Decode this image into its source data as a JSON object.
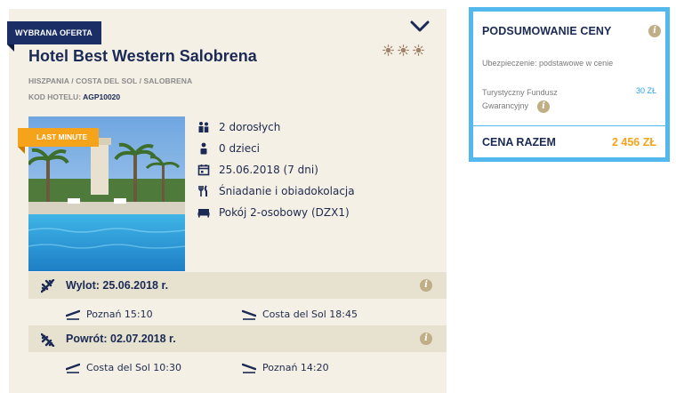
{
  "offer": {
    "ribbon": "WYBRANA OFERTA",
    "hotel_name": "Hotel Best Western Salobrena",
    "location": "HISZPANIA / COSTA DEL SOL / SALOBRENA",
    "hotel_code_label": "KOD HOTELU:",
    "hotel_code": "AGP10020",
    "star_rating": 3,
    "badge": "LAST MINUTE",
    "details": {
      "adults": "2 dorosłych",
      "children": "0 dzieci",
      "date": "25.06.2018 (7 dni)",
      "board": "Śniadanie i obiadokolacja",
      "room": "Pokój 2-osobowy (DZX1)"
    },
    "outbound": {
      "title": "Wylot: 25.06.2018 r.",
      "depart": "Poznań 15:10",
      "arrive": "Costa del Sol 18:45"
    },
    "return": {
      "title": "Powrót: 02.07.2018 r.",
      "depart": "Costa del Sol 10:30",
      "arrive": "Poznań 14:20"
    }
  },
  "summary": {
    "title": "PODSUMOWANIE CENY",
    "insurance": "Ubezpieczenie: podstawowe w cenie",
    "fund_label": "Turystyczny Fundusz Gwarancyjny",
    "fund_value": "30 ZŁ",
    "total_label": "CENA RAZEM",
    "total_value": "2 456 ZŁ"
  },
  "colors": {
    "navy": "#1b2a55",
    "accent_orange": "#f5a31a",
    "accent_blue": "#52b8ee",
    "card_bg": "#f4f0e6"
  },
  "icons": [
    "chevron-down-icon",
    "sun-rating-icon",
    "people-icon",
    "person-icon",
    "calendar-icon",
    "cutlery-icon",
    "bed-icon",
    "plane-icon",
    "takeoff-icon",
    "landing-icon",
    "info-icon"
  ]
}
